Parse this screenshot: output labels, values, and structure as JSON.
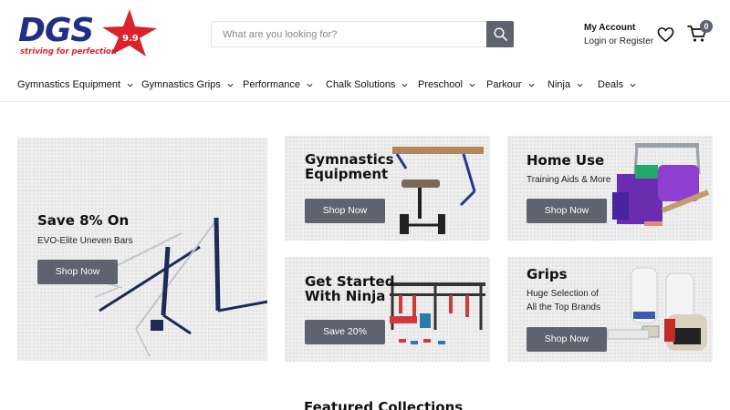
{
  "brand": {
    "name": "DGS",
    "score": "9.9",
    "tagline": "striving for perfection",
    "colors": {
      "navy": "#1f2f86",
      "red": "#d8232a"
    }
  },
  "search": {
    "placeholder": "What are you looking for?",
    "value": "",
    "icon": "search-icon"
  },
  "account": {
    "title": "My Account",
    "links": "Login or Register"
  },
  "wishlist": {
    "icon": "heart-icon"
  },
  "cart": {
    "icon": "cart-icon",
    "count": "0"
  },
  "nav": {
    "items": [
      {
        "label": "Gymnastics Equipment"
      },
      {
        "label": "Gymnastics Grips"
      },
      {
        "label": "Performance"
      },
      {
        "label": "Chalk Solutions"
      },
      {
        "label": "Preschool"
      },
      {
        "label": "Parkour"
      },
      {
        "label": "Ninja"
      },
      {
        "label": "Deals"
      }
    ]
  },
  "tiles": {
    "bars": {
      "title": "Save 8% On",
      "subtitle": "EVO-Elite Uneven Bars",
      "button": "Shop Now"
    },
    "equipment": {
      "title_line1": "Gymnastics",
      "title_line2": "Equipment",
      "button": "Shop Now"
    },
    "home": {
      "title": "Home Use",
      "subtitle": "Training Aids & More",
      "button": "Shop Now"
    },
    "ninja": {
      "title_line1": "Get Started",
      "title_line2": "With Ninja",
      "button": "Save 20%"
    },
    "grips": {
      "title": "Grips",
      "subtitle_line1": "Huge Selection of",
      "subtitle_line2": "All the Top Brands",
      "button": "Shop Now"
    }
  },
  "featured": {
    "heading": "Featured Collections"
  },
  "colors": {
    "button": "#5f6370",
    "tile_bg": "#eeeeee"
  }
}
